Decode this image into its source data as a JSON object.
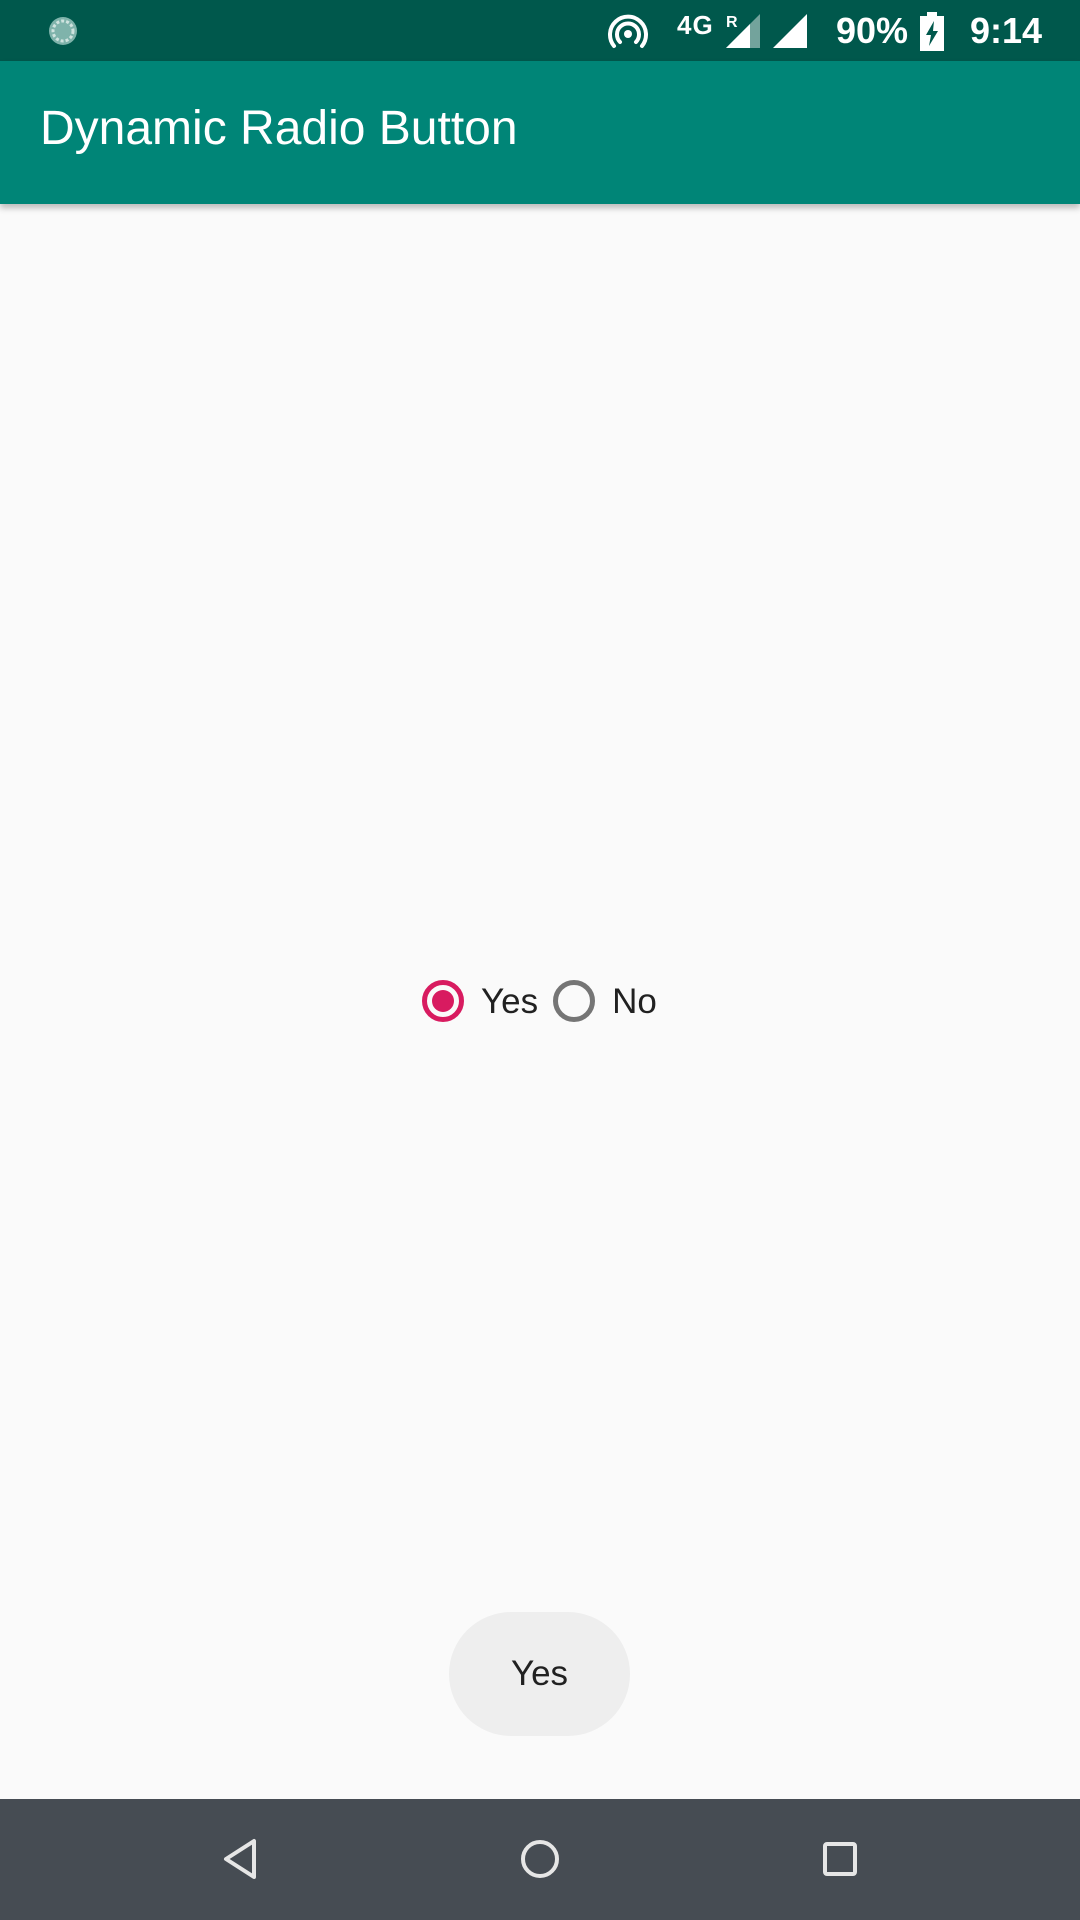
{
  "status_bar": {
    "network": "4G",
    "roaming": "R",
    "battery_percent": "90%",
    "time": "9:14",
    "icons": [
      "app-sync-icon",
      "hotspot-icon",
      "signal-roaming-icon",
      "signal-icon",
      "battery-charging-icon"
    ]
  },
  "app_bar": {
    "title": "Dynamic Radio Button"
  },
  "radio_group": {
    "options": [
      {
        "label": "Yes",
        "checked": true
      },
      {
        "label": "No",
        "checked": false
      }
    ]
  },
  "toast": {
    "text": "Yes"
  },
  "nav_bar": {
    "buttons": [
      "back-icon",
      "home-icon",
      "recents-icon"
    ]
  },
  "colors": {
    "status_bar": "#00584c",
    "app_bar": "#008577",
    "accent": "#d81b60",
    "background": "#fafafa",
    "nav_bar": "#464c53"
  }
}
